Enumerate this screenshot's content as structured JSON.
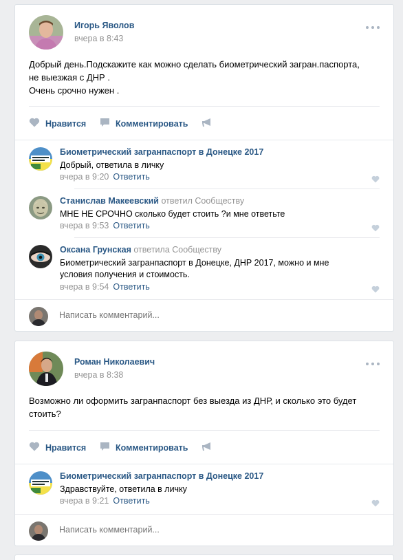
{
  "posts": [
    {
      "author": "Игорь Яволов",
      "date": "вчера в 8:43",
      "text_lines": [
        "Добрый день.Подскажите как можно сделать биометрический загран.паспорта,",
        "не выезжая с ДНР .",
        "Очень срочно нужен ."
      ],
      "actions": {
        "like": "Нравится",
        "comment": "Комментировать"
      },
      "comments": [
        {
          "author": "Биометрический загранпаспорт в Донецке 2017",
          "replied": "",
          "text": "Добрый, ответила в личку",
          "date": "вчера в 9:20",
          "reply": "Ответить"
        },
        {
          "author": "Станислав Макеевский",
          "replied": "ответил Сообществу",
          "text": "МНЕ НЕ СРОЧНО сколько будет стоить ?и мне ответьте",
          "date": "вчера в 9:53",
          "reply": "Ответить"
        },
        {
          "author": "Оксана Грунская",
          "replied": "ответила Сообществу",
          "text": "Биометрический загранпаспорт в Донецке, ДНР 2017, можно и мне условия получения и стоимость.",
          "date": "вчера в 9:54",
          "reply": "Ответить"
        }
      ],
      "write_placeholder": "Написать комментарий..."
    },
    {
      "author": "Роман Николаевич",
      "date": "вчера в 8:38",
      "text_lines": [
        "Возможно ли оформить загранпаспорт без выезда из ДНР, и сколько это будет",
        "стоить?"
      ],
      "actions": {
        "like": "Нравится",
        "comment": "Комментировать"
      },
      "comments": [
        {
          "author": "Биометрический загранпаспорт в Донецке 2017",
          "replied": "",
          "text": "Здравствуйте, ответила в личку",
          "date": "вчера в 9:21",
          "reply": "Ответить"
        }
      ],
      "write_placeholder": "Написать комментарий..."
    }
  ],
  "colors": {
    "link": "#2a5885",
    "muted": "#939393",
    "background": "#edeef0",
    "icon": "#aab5c2"
  },
  "icons": [
    "more-dots-icon",
    "heart-icon",
    "comment-icon",
    "share-megaphone-icon",
    "comment-like-heart-icon"
  ]
}
